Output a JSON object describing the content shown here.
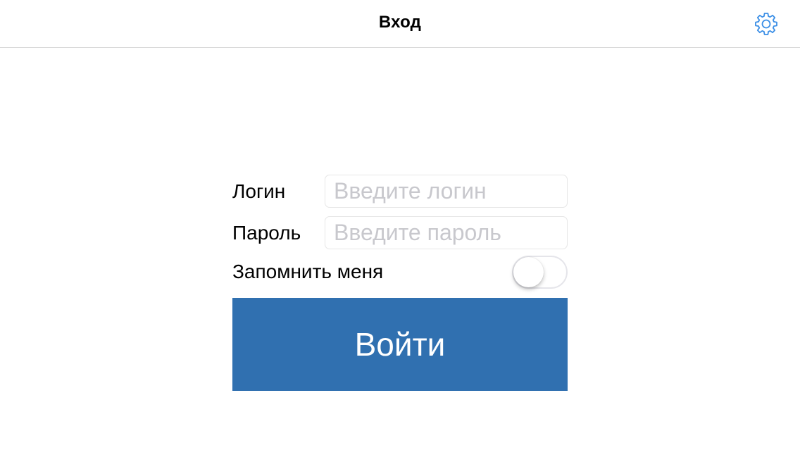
{
  "navbar": {
    "title": "Вход",
    "settings_icon": "gear-icon",
    "accent_color": "#3a8ee6"
  },
  "form": {
    "login": {
      "label": "Логин",
      "value": "",
      "placeholder": "Введите логин"
    },
    "password": {
      "label": "Пароль",
      "value": "",
      "placeholder": "Введите пароль"
    },
    "remember": {
      "label": "Запомнить меня",
      "checked": false
    },
    "submit_label": "Войти",
    "submit_color": "#3070b0"
  }
}
